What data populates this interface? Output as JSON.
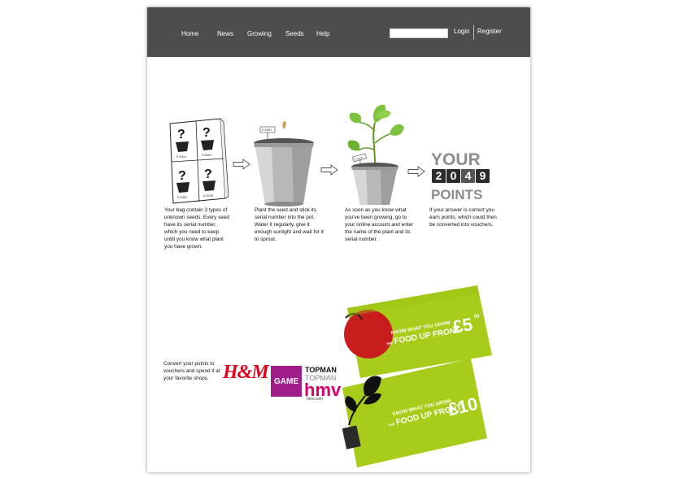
{
  "nav": {
    "items": [
      "Home",
      "News",
      "Growing",
      "Seeds",
      "Help"
    ],
    "search_placeholder": "",
    "login": "Login",
    "register": "Register"
  },
  "steps": [
    {
      "icon": "seed-bag-icon",
      "labels": [
        "D 00514",
        "D 00023",
        "D 00532",
        "D 00748"
      ],
      "text": "Your bag contain 3 types of unknown seeds. Every seed have its serial number, which you need to keep untill you know what plant you have grown."
    },
    {
      "icon": "pot-with-seed-icon",
      "pot_label": "D 00531",
      "text": "Plant the seed and stick its serial number into the pot. Water it regularly, give it enough sunlight and wait for it to sprout."
    },
    {
      "icon": "pot-with-plant-icon",
      "pot_label": "D 00531",
      "text": "As soon as you know what you've been growing, go to your online account and enter the name of the plant and its serial number."
    },
    {
      "icon": "points-counter-icon",
      "title_top": "YOUR",
      "title_bottom": "POINTS",
      "digits": [
        "2",
        "0",
        "4",
        "9"
      ],
      "text": "If your answer is correct you earn points, which could then be converted into vouchers."
    }
  ],
  "convert_text": "Convert your points to vouchers and spend it at your favorite shops.",
  "brands": {
    "hm": "H&M",
    "game": "GAME",
    "topman": "TOPMAN",
    "topman_secondary": "TOPMAN",
    "hmv": "hmv",
    "hmv_url": "hmv.com"
  },
  "vouchers": [
    {
      "line1": "KNOW WHAT YOU GROW",
      "line2": "FOOD UP FRONT",
      "amount": "£5",
      "pence": "00",
      "prefix": "THE",
      "color": "#a7cc1a"
    },
    {
      "line1": "KNOW WHAT YOU GROW",
      "line2": "FOOD UP FRONT",
      "amount": "£10",
      "pence": "00",
      "prefix": "THE",
      "color": "#a7cc1a"
    }
  ]
}
